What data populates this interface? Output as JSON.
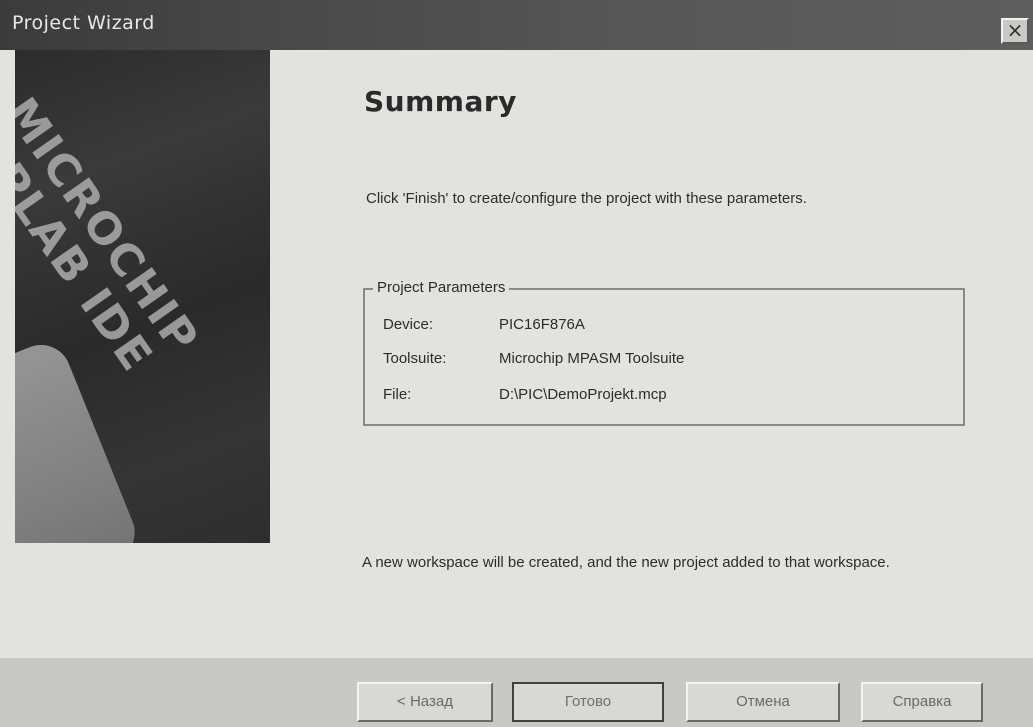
{
  "window": {
    "title": "Project Wizard",
    "close_label": "×"
  },
  "side_image": {
    "alt": "MICROCHIP MPLAB IDE"
  },
  "main": {
    "heading": "Summary",
    "instruction": "Click 'Finish' to create/configure the project with these parameters.",
    "group_title": "Project Parameters",
    "params": [
      {
        "label": "Device:",
        "value": "PIC16F876A"
      },
      {
        "label": "Toolsuite:",
        "value": "Microchip MPASM Toolsuite"
      },
      {
        "label": "File:",
        "value": "D:\\PIC\\DemoProjekt.mcp"
      }
    ],
    "footer": "A new workspace will be created, and the new project added to that workspace."
  },
  "buttons": {
    "back": "< Назад",
    "finish": "Готово",
    "cancel": "Отмена",
    "help": "Справка"
  }
}
